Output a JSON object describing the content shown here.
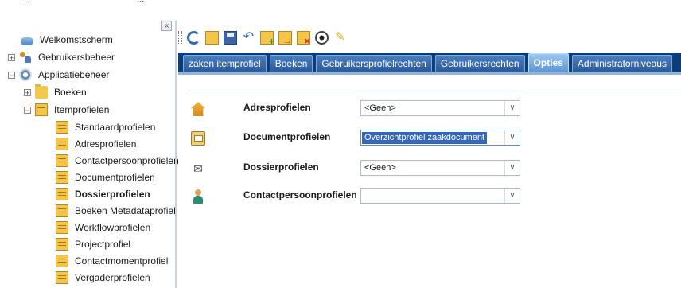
{
  "topbar": {
    "left_text": "...",
    "title": "..."
  },
  "tree": {
    "collapse_label": "«",
    "items": [
      {
        "label": "Welkomstscherm"
      },
      {
        "label": "Gebruikersbeheer",
        "toggle": "+"
      },
      {
        "label": "Applicatiebeheer",
        "toggle": "−"
      },
      {
        "label": "Boeken",
        "toggle": "+"
      },
      {
        "label": "Itemprofielen",
        "toggle": "−"
      },
      {
        "label": "Standaardprofielen"
      },
      {
        "label": "Adresprofielen"
      },
      {
        "label": "Contactpersoonprofielen"
      },
      {
        "label": "Documentprofielen"
      },
      {
        "label": "Dossierprofielen"
      },
      {
        "label": "Boeken Metadataprofiel"
      },
      {
        "label": "Workflowprofielen"
      },
      {
        "label": "Projectprofiel"
      },
      {
        "label": "Contactmomentprofiel"
      },
      {
        "label": "Vergaderprofielen"
      }
    ]
  },
  "toolbar": {
    "icons": [
      "refresh-icon",
      "grid-icon",
      "save-icon",
      "undo-icon",
      "add-icon",
      "move-icon",
      "delete-icon",
      "view-icon",
      "edit-icon"
    ],
    "undo_glyph": "↶",
    "edit_glyph": "✎"
  },
  "tabs": [
    {
      "label": "zaken itemprofiel"
    },
    {
      "label": "Boeken"
    },
    {
      "label": "Gebruikersprofielrechten"
    },
    {
      "label": "Gebruikersrechten"
    },
    {
      "label": "Opties",
      "active": true
    },
    {
      "label": "Administratorniveaus"
    }
  ],
  "options": {
    "rows": [
      {
        "label": "Adresprofielen",
        "value": "<Geen>",
        "icon": "house-icon"
      },
      {
        "label": "Documentprofielen",
        "value": "Overzichtprofiel zaakdocument",
        "icon": "document-icon"
      },
      {
        "label": "Dossierprofielen",
        "value": "<Geen>",
        "icon": "dossier-icon"
      },
      {
        "label": "Contactpersoonprofielen",
        "value": "",
        "icon": "person-icon"
      }
    ],
    "dropdown_arrow": "∨",
    "dossier_glyph": "✉"
  }
}
